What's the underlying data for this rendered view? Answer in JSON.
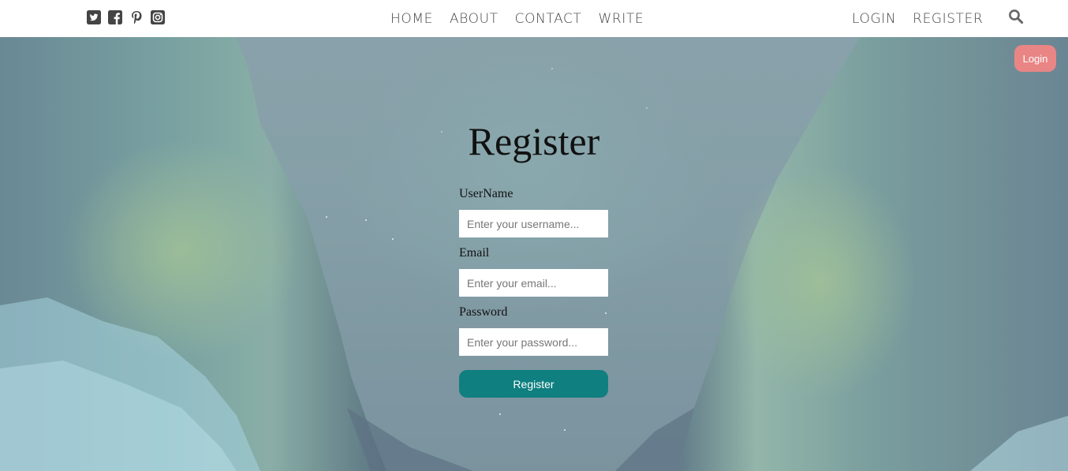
{
  "nav": {
    "social": [
      {
        "name": "twitter-icon",
        "label": "Twitter"
      },
      {
        "name": "facebook-icon",
        "label": "Facebook"
      },
      {
        "name": "pinterest-icon",
        "label": "Pinterest"
      },
      {
        "name": "instagram-icon",
        "label": "Instagram"
      }
    ],
    "links": [
      "HOME",
      "ABOUT",
      "CONTACT",
      "WRITE"
    ],
    "login_label": "LOGIN",
    "register_label": "REGISTER",
    "search_icon": "search-icon"
  },
  "float_login": {
    "label": "Login",
    "color": "#e98585"
  },
  "register": {
    "title": "Register",
    "username": {
      "label": "UserName",
      "placeholder": "Enter your username..."
    },
    "email": {
      "label": "Email",
      "placeholder": "Enter your email..."
    },
    "password": {
      "label": "Password",
      "placeholder": "Enter your password..."
    },
    "submit_label": "Register",
    "submit_color": "#0f7f80"
  }
}
